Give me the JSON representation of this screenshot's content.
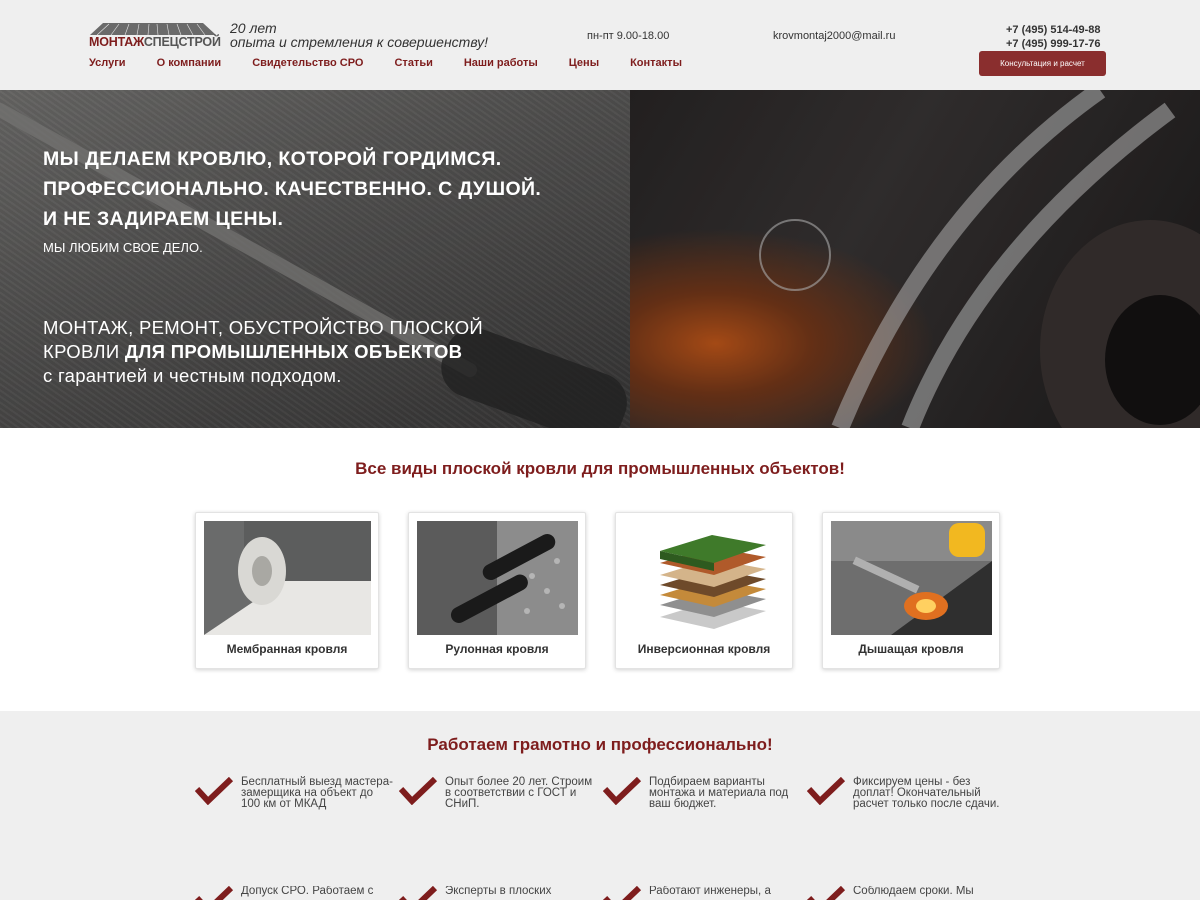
{
  "header": {
    "logo": {
      "part1": "МОНТАЖ",
      "part2": "СПЕЦСТРОЙ"
    },
    "tagline_line1": "20 лет",
    "tagline_line2": "опыта и стремления к совершенству!",
    "hours": "пн-пт 9.00-18.00",
    "email": "krovmontaj2000@mail.ru",
    "phone1": "+7 (495) 514-49-88",
    "phone2": "+7 (495) 999-17-76",
    "consult_button": "Консультация и расчет",
    "nav": [
      "Услуги",
      "О компании",
      "Свидетельство СРО",
      "Статьи",
      "Наши работы",
      "Цены",
      "Контакты"
    ]
  },
  "hero": {
    "line1": "Мы делаем кровлю, которой гордимся.",
    "line2": "Профессионально. Качественно. С душой.",
    "line3": "И не задираем цены.",
    "sub": "Мы любим свое дело.",
    "h2_part1": "Монтаж, ремонт, обустройство плоской",
    "h2_part2": "кровли",
    "h2_bold": "для промышленных объектов",
    "h2_part3": "с гарантией и честным подходом."
  },
  "types": {
    "title": "Все виды плоской кровли для промышленных объектов!",
    "cards": [
      {
        "label": "Мембранная кровля"
      },
      {
        "label": "Рулонная кровля"
      },
      {
        "label": "Инверсионная кровля"
      },
      {
        "label": "Дышащая кровля"
      }
    ]
  },
  "advantages": {
    "title": "Работаем грамотно и профессионально!",
    "items": [
      {
        "text": "Бесплатный выезд мастера-замерщика на объект до 100 км от МКАД"
      },
      {
        "text": "Опыт более 20 лет. Строим в соответствии с ГОСТ и СНиП."
      },
      {
        "text": "Подбираем варианты монтажа и материала под ваш бюджет."
      },
      {
        "text": "Фиксируем цены - без доплат! Окончательный расчет только после сдачи."
      },
      {
        "text": "Допуск СРО. Работаем с"
      },
      {
        "text": "Эксперты в плоских"
      },
      {
        "text": "Работают инженеры, а"
      },
      {
        "text": "Соблюдаем сроки. Мы"
      }
    ]
  },
  "colors": {
    "brand": "#7e1d1d",
    "button": "#8a2e2e",
    "header_bg": "#efefef"
  },
  "icons": {
    "check": "check-icon"
  }
}
